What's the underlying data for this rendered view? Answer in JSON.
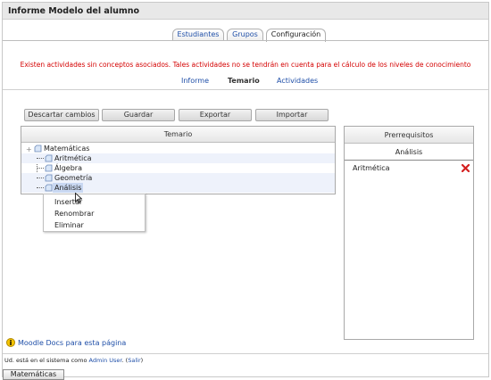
{
  "titlebar": {
    "title": "Informe Modelo del alumno"
  },
  "tabs": [
    {
      "label": "Estudiantes",
      "active": false
    },
    {
      "label": "Grupos",
      "active": false
    },
    {
      "label": "Configuración",
      "active": true
    }
  ],
  "warning": "Existen actividades sin conceptos asociados. Tales actividades no se tendrán en cuenta para el cálculo de los niveles de conocimiento",
  "subtabs": [
    {
      "label": "Informe",
      "active": false
    },
    {
      "label": "Temario",
      "active": true
    },
    {
      "label": "Actividades",
      "active": false
    }
  ],
  "toolbar": {
    "discard_label": "Descartar cambios",
    "save_label": "Guardar",
    "export_label": "Exportar",
    "import_label": "Importar"
  },
  "temario": {
    "header": "Temario",
    "root": "Matemáticas",
    "children": [
      "Aritmética",
      "Álgebra",
      "Geometría",
      "Análisis"
    ],
    "selected": "Análisis"
  },
  "context_menu": [
    "Insertar",
    "Renombrar",
    "Eliminar"
  ],
  "prerequisitos": {
    "header": "Prerrequisitos",
    "subject": "Análisis",
    "items": [
      "Aritmética"
    ]
  },
  "docs": {
    "link": "Moodle Docs para esta página"
  },
  "footer": {
    "prefix": "Ud. está en el sistema como",
    "user": "Admin User",
    "logout": "Salir"
  },
  "bottom_button": "Matemáticas",
  "colors": {
    "warning": "#d40000",
    "link": "#1f4fa8",
    "delete": "#d42020"
  }
}
